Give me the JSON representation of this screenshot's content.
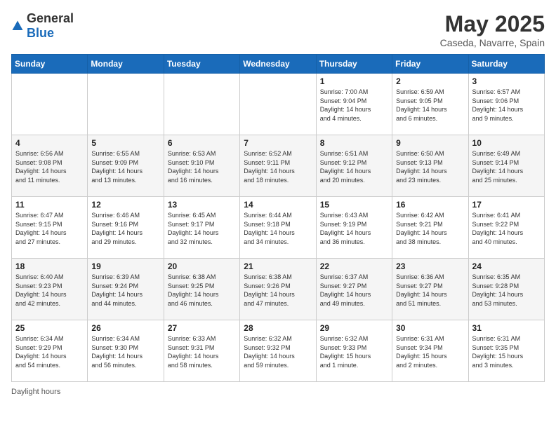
{
  "header": {
    "logo_general": "General",
    "logo_blue": "Blue",
    "month": "May 2025",
    "location": "Caseda, Navarre, Spain"
  },
  "weekdays": [
    "Sunday",
    "Monday",
    "Tuesday",
    "Wednesday",
    "Thursday",
    "Friday",
    "Saturday"
  ],
  "weeks": [
    [
      {
        "day": "",
        "info": ""
      },
      {
        "day": "",
        "info": ""
      },
      {
        "day": "",
        "info": ""
      },
      {
        "day": "",
        "info": ""
      },
      {
        "day": "1",
        "info": "Sunrise: 7:00 AM\nSunset: 9:04 PM\nDaylight: 14 hours\nand 4 minutes."
      },
      {
        "day": "2",
        "info": "Sunrise: 6:59 AM\nSunset: 9:05 PM\nDaylight: 14 hours\nand 6 minutes."
      },
      {
        "day": "3",
        "info": "Sunrise: 6:57 AM\nSunset: 9:06 PM\nDaylight: 14 hours\nand 9 minutes."
      }
    ],
    [
      {
        "day": "4",
        "info": "Sunrise: 6:56 AM\nSunset: 9:08 PM\nDaylight: 14 hours\nand 11 minutes."
      },
      {
        "day": "5",
        "info": "Sunrise: 6:55 AM\nSunset: 9:09 PM\nDaylight: 14 hours\nand 13 minutes."
      },
      {
        "day": "6",
        "info": "Sunrise: 6:53 AM\nSunset: 9:10 PM\nDaylight: 14 hours\nand 16 minutes."
      },
      {
        "day": "7",
        "info": "Sunrise: 6:52 AM\nSunset: 9:11 PM\nDaylight: 14 hours\nand 18 minutes."
      },
      {
        "day": "8",
        "info": "Sunrise: 6:51 AM\nSunset: 9:12 PM\nDaylight: 14 hours\nand 20 minutes."
      },
      {
        "day": "9",
        "info": "Sunrise: 6:50 AM\nSunset: 9:13 PM\nDaylight: 14 hours\nand 23 minutes."
      },
      {
        "day": "10",
        "info": "Sunrise: 6:49 AM\nSunset: 9:14 PM\nDaylight: 14 hours\nand 25 minutes."
      }
    ],
    [
      {
        "day": "11",
        "info": "Sunrise: 6:47 AM\nSunset: 9:15 PM\nDaylight: 14 hours\nand 27 minutes."
      },
      {
        "day": "12",
        "info": "Sunrise: 6:46 AM\nSunset: 9:16 PM\nDaylight: 14 hours\nand 29 minutes."
      },
      {
        "day": "13",
        "info": "Sunrise: 6:45 AM\nSunset: 9:17 PM\nDaylight: 14 hours\nand 32 minutes."
      },
      {
        "day": "14",
        "info": "Sunrise: 6:44 AM\nSunset: 9:18 PM\nDaylight: 14 hours\nand 34 minutes."
      },
      {
        "day": "15",
        "info": "Sunrise: 6:43 AM\nSunset: 9:19 PM\nDaylight: 14 hours\nand 36 minutes."
      },
      {
        "day": "16",
        "info": "Sunrise: 6:42 AM\nSunset: 9:21 PM\nDaylight: 14 hours\nand 38 minutes."
      },
      {
        "day": "17",
        "info": "Sunrise: 6:41 AM\nSunset: 9:22 PM\nDaylight: 14 hours\nand 40 minutes."
      }
    ],
    [
      {
        "day": "18",
        "info": "Sunrise: 6:40 AM\nSunset: 9:23 PM\nDaylight: 14 hours\nand 42 minutes."
      },
      {
        "day": "19",
        "info": "Sunrise: 6:39 AM\nSunset: 9:24 PM\nDaylight: 14 hours\nand 44 minutes."
      },
      {
        "day": "20",
        "info": "Sunrise: 6:38 AM\nSunset: 9:25 PM\nDaylight: 14 hours\nand 46 minutes."
      },
      {
        "day": "21",
        "info": "Sunrise: 6:38 AM\nSunset: 9:26 PM\nDaylight: 14 hours\nand 47 minutes."
      },
      {
        "day": "22",
        "info": "Sunrise: 6:37 AM\nSunset: 9:27 PM\nDaylight: 14 hours\nand 49 minutes."
      },
      {
        "day": "23",
        "info": "Sunrise: 6:36 AM\nSunset: 9:27 PM\nDaylight: 14 hours\nand 51 minutes."
      },
      {
        "day": "24",
        "info": "Sunrise: 6:35 AM\nSunset: 9:28 PM\nDaylight: 14 hours\nand 53 minutes."
      }
    ],
    [
      {
        "day": "25",
        "info": "Sunrise: 6:34 AM\nSunset: 9:29 PM\nDaylight: 14 hours\nand 54 minutes."
      },
      {
        "day": "26",
        "info": "Sunrise: 6:34 AM\nSunset: 9:30 PM\nDaylight: 14 hours\nand 56 minutes."
      },
      {
        "day": "27",
        "info": "Sunrise: 6:33 AM\nSunset: 9:31 PM\nDaylight: 14 hours\nand 58 minutes."
      },
      {
        "day": "28",
        "info": "Sunrise: 6:32 AM\nSunset: 9:32 PM\nDaylight: 14 hours\nand 59 minutes."
      },
      {
        "day": "29",
        "info": "Sunrise: 6:32 AM\nSunset: 9:33 PM\nDaylight: 15 hours\nand 1 minute."
      },
      {
        "day": "30",
        "info": "Sunrise: 6:31 AM\nSunset: 9:34 PM\nDaylight: 15 hours\nand 2 minutes."
      },
      {
        "day": "31",
        "info": "Sunrise: 6:31 AM\nSunset: 9:35 PM\nDaylight: 15 hours\nand 3 minutes."
      }
    ]
  ],
  "footer": {
    "label": "Daylight hours"
  }
}
